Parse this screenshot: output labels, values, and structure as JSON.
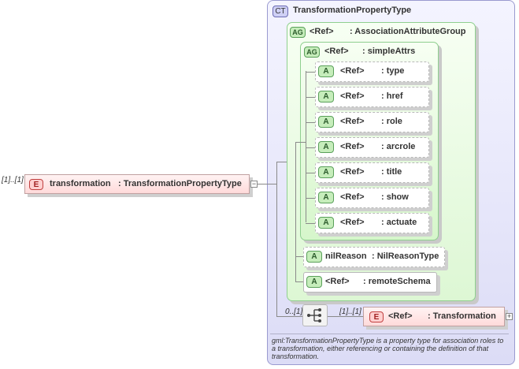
{
  "complex_type": {
    "badge": "CT",
    "name": "TransformationPropertyType"
  },
  "attribute_group": {
    "badge": "AG",
    "ref": "<Ref>",
    "name": ": AssociationAttributeGroup"
  },
  "simple_attrs_group": {
    "badge": "AG",
    "ref": "<Ref>",
    "name": ": simpleAttrs"
  },
  "simple_attrs": [
    {
      "badge": "A",
      "ref": "<Ref>",
      "name": ": type"
    },
    {
      "badge": "A",
      "ref": "<Ref>",
      "name": ": href"
    },
    {
      "badge": "A",
      "ref": "<Ref>",
      "name": ": role"
    },
    {
      "badge": "A",
      "ref": "<Ref>",
      "name": ": arcrole"
    },
    {
      "badge": "A",
      "ref": "<Ref>",
      "name": ": title"
    },
    {
      "badge": "A",
      "ref": "<Ref>",
      "name": ": show"
    },
    {
      "badge": "A",
      "ref": "<Ref>",
      "name": ": actuate"
    }
  ],
  "nil_reason": {
    "badge": "A",
    "name": "nilReason",
    "type": ": NilReasonType"
  },
  "remote_schema": {
    "badge": "A",
    "ref": "<Ref>",
    "name": ": remoteSchema"
  },
  "root_element": {
    "cardinality": "[1]..[1]",
    "badge": "E",
    "name": "transformation",
    "type": ": TransformationPropertyType",
    "toggle": "−"
  },
  "sequence": {
    "cardinality": "0..[1]"
  },
  "child_element": {
    "cardinality": "[1]..[1]",
    "badge": "E",
    "ref": "<Ref>",
    "name": ": Transformation",
    "toggle": "+"
  },
  "documentation": "gml:TransformationPropertyType is a property type for association roles to a transformation, either referencing or containing the definition of that transformation."
}
